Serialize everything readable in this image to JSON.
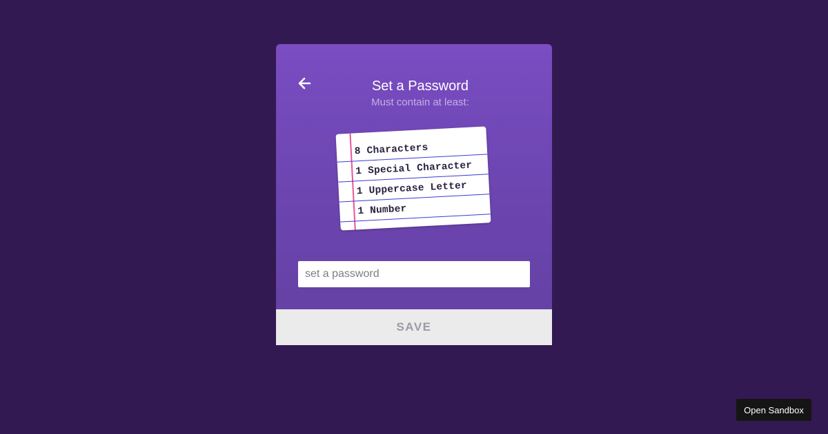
{
  "card": {
    "title": "Set a Password",
    "subtitle": "Must contain at least:",
    "back_icon": "arrow-left-icon"
  },
  "requirements": {
    "items": [
      "8 Characters",
      "1 Special Character",
      "1 Uppercase Letter",
      "1 Number"
    ]
  },
  "password_field": {
    "placeholder": "set a password",
    "value": ""
  },
  "save_button": {
    "label": "SAVE"
  },
  "sandbox_button": {
    "label": "Open Sandbox"
  },
  "colors": {
    "page_background": "#331951",
    "card_gradient_top": "#7a4dc2",
    "card_gradient_bottom": "#6341a2",
    "subtitle": "#c2aeea",
    "note_rule": "#3a3ad8",
    "note_margin": "#e8569a",
    "save_background": "#ebebeb",
    "save_text": "#9a9aa6"
  }
}
